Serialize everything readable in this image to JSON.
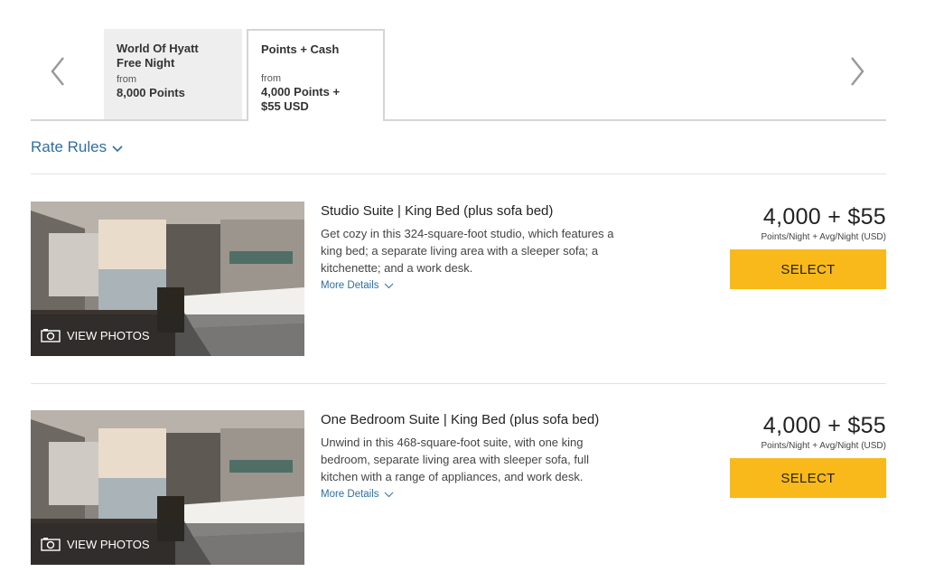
{
  "tabs": {
    "free_night": {
      "title_line1": "World Of Hyatt",
      "title_line2": "Free Night",
      "from": "from",
      "price": "8,000 Points"
    },
    "points_cash": {
      "title": "Points + Cash",
      "from": "from",
      "price_line1": "4,000 Points +",
      "price_line2": "$55 USD"
    },
    "prev_icon": "chevron-left-icon",
    "next_icon": "chevron-right-icon"
  },
  "rate_rules": {
    "label": "Rate Rules"
  },
  "rooms": [
    {
      "view_photos": "VIEW PHOTOS",
      "name": "Studio Suite | King Bed (plus sofa bed)",
      "desc_line1": "Get cozy in this 324-square-foot studio, which features a",
      "desc_line2": "king bed; a separate living area with a sleeper sofa; a",
      "desc_line3": "kitchenette; and a work desk.",
      "more_details": "More Details",
      "price": "4,000 + $55",
      "price_sub": "Points/Night + Avg/Night (USD)",
      "select": "SELECT"
    },
    {
      "view_photos": "VIEW PHOTOS",
      "name": "One Bedroom Suite | King Bed (plus sofa bed)",
      "desc_line1": "Unwind in this 468-square-foot suite, with one king",
      "desc_line2": "bedroom, separate living area with sleeper sofa, full",
      "desc_line3": "kitchen with a range of appliances, and work desk.",
      "more_details": "More Details",
      "price": "4,000 + $55",
      "price_sub": "Points/Night + Avg/Night (USD)",
      "select": "SELECT"
    }
  ],
  "colors": {
    "link": "#2f6f9f",
    "select_button": "#f9b91a",
    "inactive_tab": "#eeeeee"
  }
}
